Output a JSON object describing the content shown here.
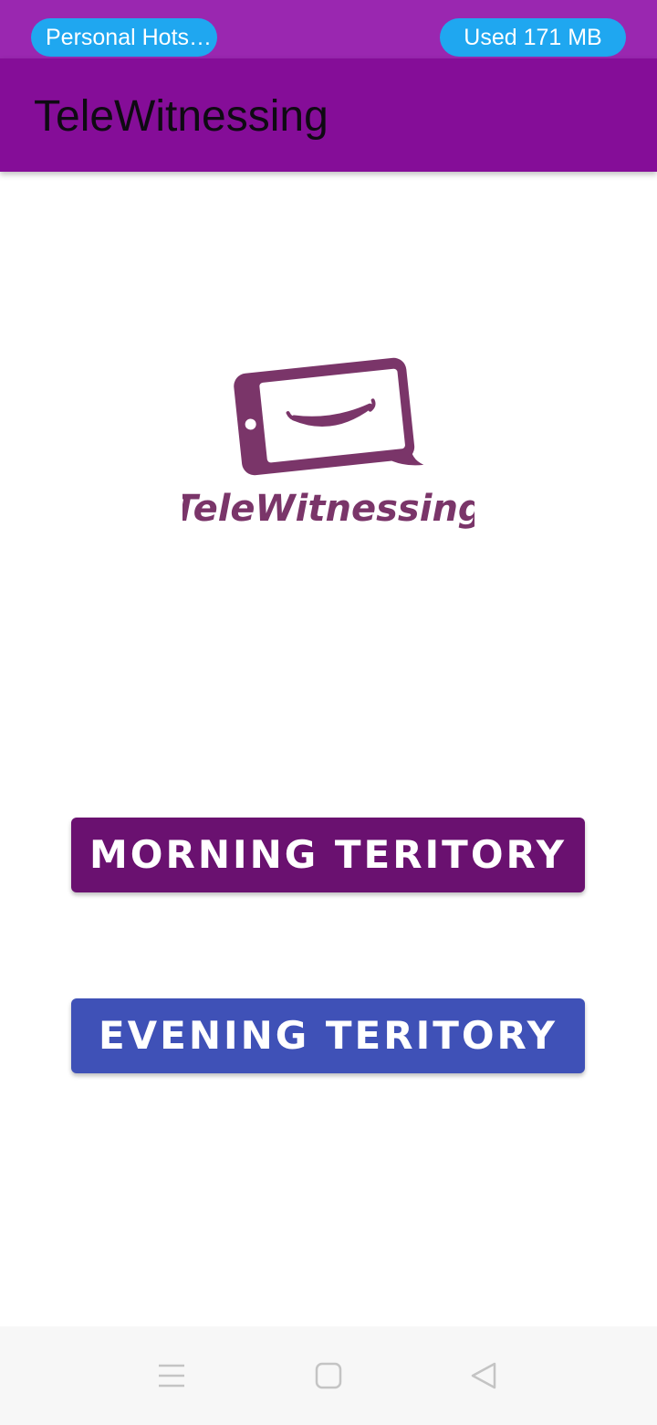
{
  "status_bar": {
    "hotspot_label": "Personal Hots…",
    "data_usage": "Used  171 MB"
  },
  "app_bar": {
    "title": "TeleWitnessing"
  },
  "logo": {
    "text": "TeleWitnessing",
    "icon": "smiling-phone-chat-icon"
  },
  "buttons": {
    "morning": "MORNING TERITORY",
    "evening": "EVENING TERITORY"
  },
  "nav": {
    "menu_icon": "menu-icon",
    "home_icon": "home-icon",
    "back_icon": "back-icon"
  },
  "colors": {
    "status_bar": "#9a27b0",
    "app_bar": "#850d98",
    "morning_button": "#6a1170",
    "evening_button": "#3f51b7",
    "pill": "#1fa7f0",
    "logo": "#7a3569"
  }
}
